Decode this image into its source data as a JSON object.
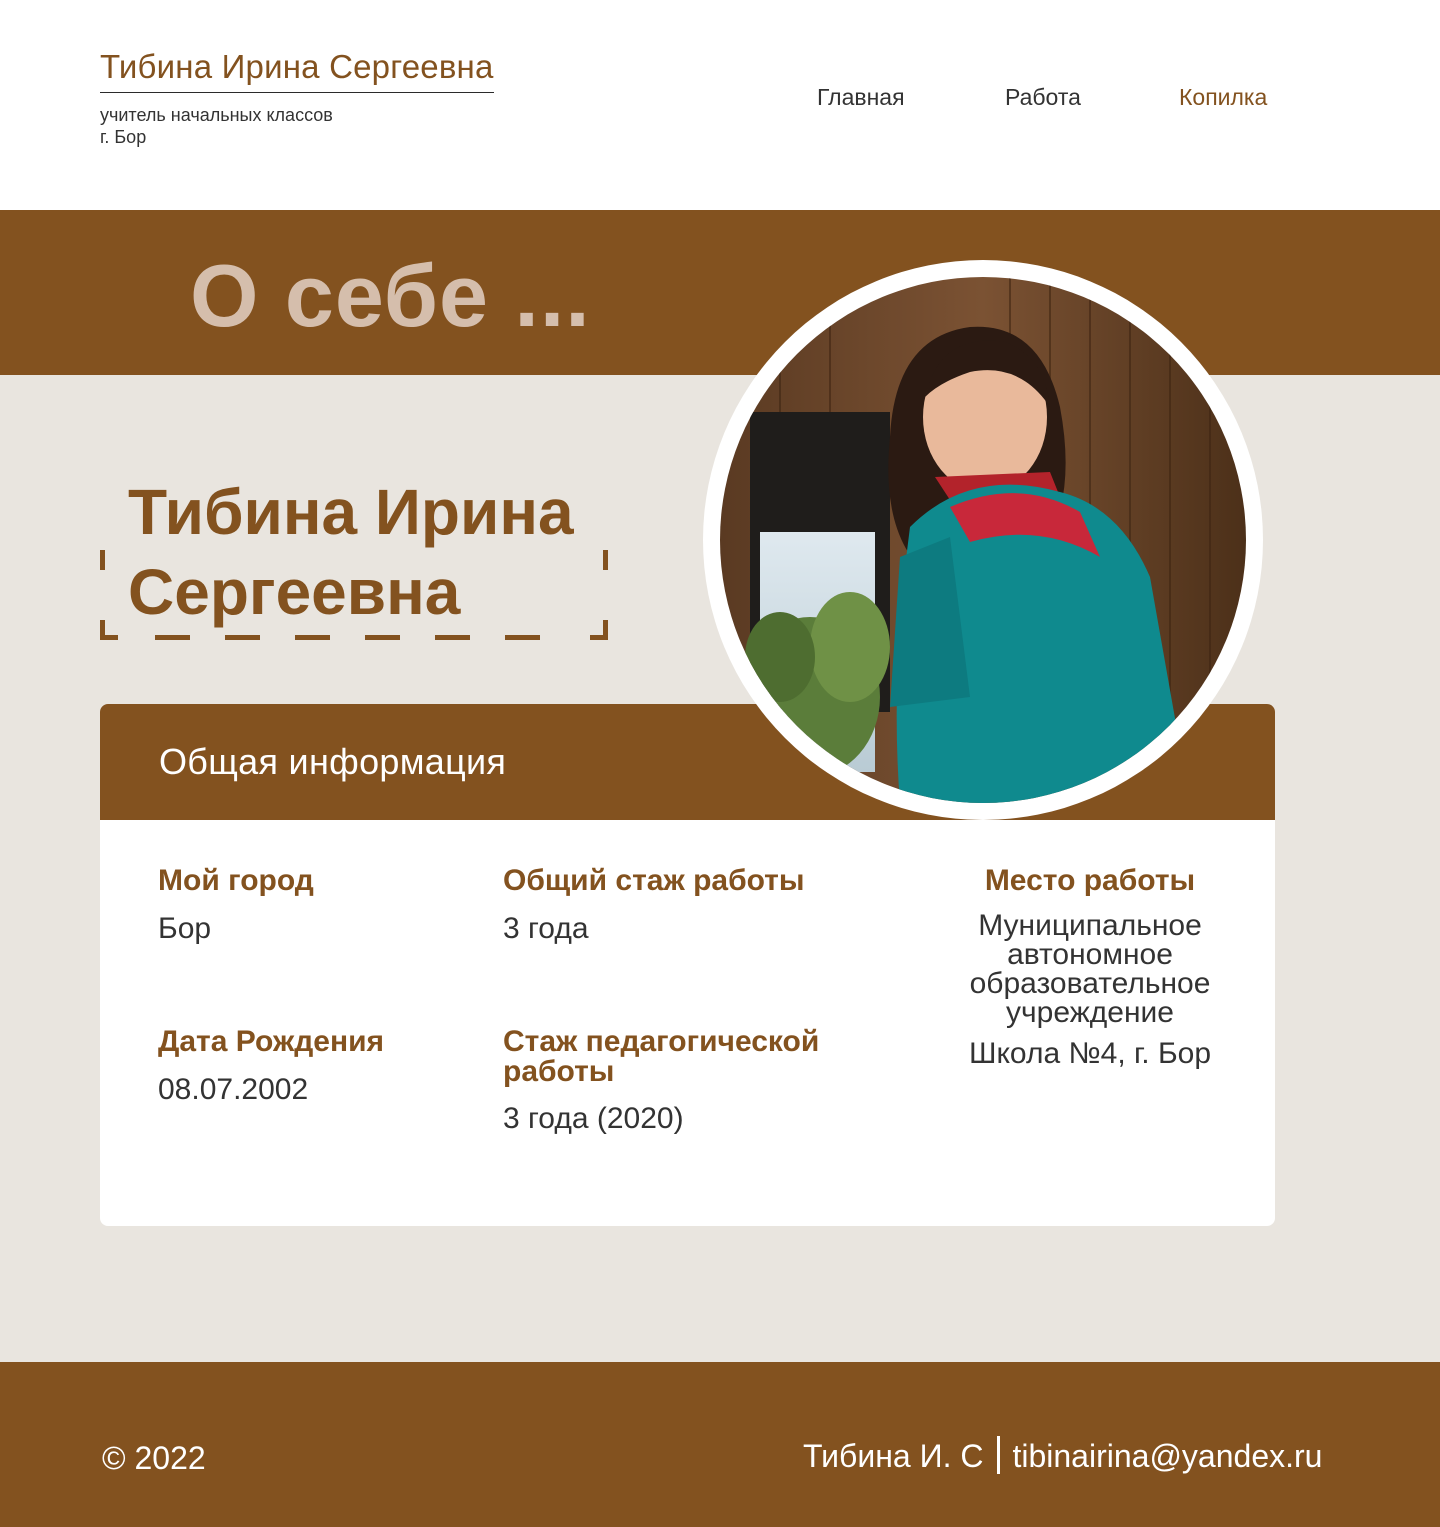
{
  "header": {
    "site_title": "Тибина Ирина Сергеевна",
    "subtitle_line1": "учитель начальных классов",
    "subtitle_line2": "г. Бор",
    "nav": [
      {
        "label": "Главная",
        "active": false
      },
      {
        "label": "Работа",
        "active": false
      },
      {
        "label": "Копилка",
        "active": true
      }
    ]
  },
  "hero": {
    "title": "О себе ...",
    "name_line1": "Тибина Ирина",
    "name_line2": "Сергеевна"
  },
  "info": {
    "title": "Общая информация",
    "city_label": "Мой город",
    "city_value": "Бор",
    "birth_label": "Дата Рождения",
    "birth_value": "08.07.2002",
    "total_label": "Общий стаж работы",
    "total_value": "3 года",
    "ped_label_line1": "Стаж педагогической",
    "ped_label_line2": "работы",
    "ped_value": "3 года (2020)",
    "work_label": "Место работы",
    "work_lines": [
      "Муниципальное",
      "автономное",
      "образовательное",
      "учреждение"
    ],
    "work_school": "Школа №4, г. Бор"
  },
  "footer": {
    "copyright": "© 2022",
    "author": "Тибина И. С",
    "email": "tibinairina@yandex.ru"
  },
  "colors": {
    "brand": "#83521F",
    "accent_light": "#D5BEAC",
    "background": "#E9E5DF",
    "text": "#333333"
  }
}
